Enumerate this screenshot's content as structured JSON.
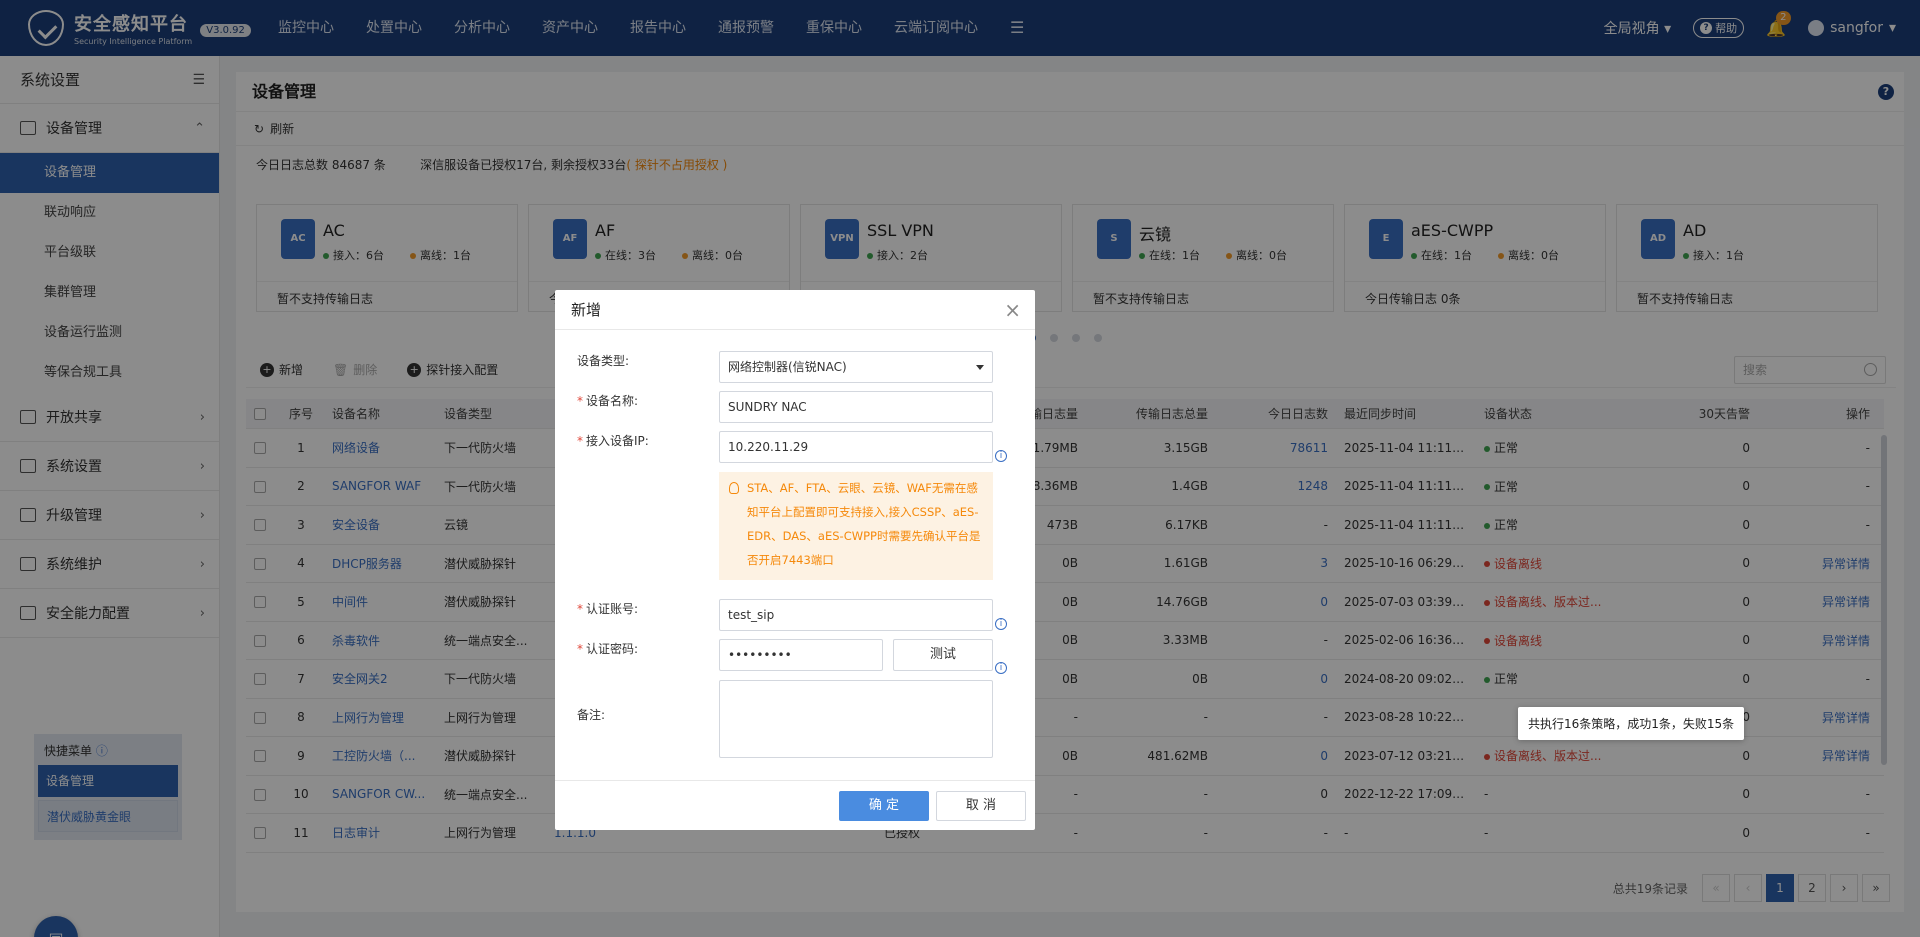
{
  "app": {
    "title": "安全感知平台",
    "subtitle": "Security Intelligence Platform",
    "version": "V3.0.92"
  },
  "nav": {
    "items": [
      "监控中心",
      "处置中心",
      "分析中心",
      "资产中心",
      "报告中心",
      "通报预警",
      "重保中心",
      "云端订阅中心"
    ],
    "more_icon": "hamburger-icon",
    "view_label": "全局视角",
    "help_label": "帮助",
    "bell_badge": "2",
    "user_label": "sangfor"
  },
  "sidebar": {
    "title": "系统设置",
    "groups": [
      {
        "label": "设备管理",
        "icon": "device-icon",
        "expanded": true
      },
      {
        "label": "开放共享",
        "icon": "share-icon"
      },
      {
        "label": "系统设置",
        "icon": "gear-icon"
      },
      {
        "label": "升级管理",
        "icon": "upload-icon"
      },
      {
        "label": "系统维护",
        "icon": "wrench-icon"
      },
      {
        "label": "安全能力配置",
        "icon": "grid-icon"
      }
    ],
    "subitems": [
      "设备管理",
      "联动响应",
      "平台级联",
      "集群管理",
      "设备运行监测",
      "等保合规工具"
    ],
    "quick_title": "快捷菜单",
    "quick_items": [
      "设备管理",
      "潜伏威胁黄金眼"
    ]
  },
  "main": {
    "title": "设备管理",
    "refresh_label": "刷新",
    "info_left": "今日日志总数 84687 条",
    "info_right": "深信服设备已授权17台, 剩余授权33台",
    "info_link": "( 探针不占用授权 )",
    "cards": [
      {
        "name": "AC",
        "stat1": "接入：6台",
        "stat2": "离线：1台",
        "foot": "暂不支持传输日志",
        "icon": "ac-icon",
        "icon_text": "AC"
      },
      {
        "name": "AF",
        "stat1": "在线：3台",
        "stat2": "离线：0台",
        "foot": "今日传输日志 0条",
        "icon": "af-icon",
        "icon_text": "AF"
      },
      {
        "name": "SSL VPN",
        "stat1": "接入：2台",
        "stat2": "",
        "foot": "暂不支持传输日志",
        "icon": "vpn-icon",
        "icon_text": "VPN"
      },
      {
        "name": "云镜",
        "stat1": "在线：1台",
        "stat2": "离线：0台",
        "foot": "暂不支持传输日志",
        "icon": "cloud-mirror-icon",
        "icon_text": "S"
      },
      {
        "name": "aES-CWPP",
        "stat1": "在线：1台",
        "stat2": "离线：0台",
        "foot": "今日传输日志 0条",
        "icon": "cwpp-icon",
        "icon_text": "E"
      },
      {
        "name": "AD",
        "stat1": "接入：1台",
        "stat2": "",
        "foot": "暂不支持传输日志",
        "icon": "ad-icon",
        "icon_text": "AD"
      }
    ],
    "toolbar": {
      "add": "新增",
      "delete": "删除",
      "probe": "探针接入配置",
      "search_placeholder": "搜索"
    },
    "columns": [
      "序号",
      "设备名称",
      "设备类型",
      "",
      "",
      "今日传输日志量",
      "传输日志总量",
      "今日日志数",
      "最近同步时间",
      "设备状态",
      "30天告警",
      "操作"
    ],
    "rows": [
      {
        "no": "1",
        "name": "网络设备",
        "type": "下一代防火墙",
        "ip": "",
        "c5": "",
        "today": "21.79MB",
        "total": "3.15GB",
        "count": "78611",
        "time": "2025-11-04 11:11:10",
        "status": "正常",
        "dot": "g",
        "alerts": "0",
        "op": "-"
      },
      {
        "no": "2",
        "name": "SANGFOR WAF",
        "type": "下一代防火墙",
        "ip": "",
        "c5": "",
        "today": "8.36MB",
        "total": "1.4GB",
        "count": "1248",
        "time": "2025-11-04 11:11:04",
        "status": "正常",
        "dot": "g",
        "alerts": "0",
        "op": "-"
      },
      {
        "no": "3",
        "name": "安全设备",
        "type": "云镜",
        "ip": "",
        "c5": "",
        "today": "473B",
        "total": "6.17KB",
        "count": "-",
        "time": "2025-11-04 11:11:02",
        "status": "正常",
        "dot": "g",
        "alerts": "0",
        "op": "-"
      },
      {
        "no": "4",
        "name": "DHCP服务器",
        "type": "潜伏威胁探针",
        "ip": "",
        "c5": "",
        "today": "0B",
        "total": "1.61GB",
        "count": "3",
        "time": "2025-10-16 06:29:47",
        "status": "设备离线",
        "dot": "r",
        "alerts": "0",
        "op": "异常详情"
      },
      {
        "no": "5",
        "name": "中间件",
        "type": "潜伏威胁探针",
        "ip": "",
        "c5": "",
        "today": "0B",
        "total": "14.76GB",
        "count": "0",
        "time": "2025-07-03 03:39:29",
        "status": "设备离线、版本过...",
        "dot": "r",
        "alerts": "0",
        "op": "异常详情"
      },
      {
        "no": "6",
        "name": "杀毒软件",
        "type": "统一端点安全...",
        "ip": "",
        "c5": "",
        "today": "0B",
        "total": "3.33MB",
        "count": "-",
        "time": "2025-02-06 16:36:08",
        "status": "设备离线",
        "dot": "r",
        "alerts": "0",
        "op": "异常详情"
      },
      {
        "no": "7",
        "name": "安全网关2",
        "type": "下一代防火墙",
        "ip": "",
        "c5": "",
        "today": "0B",
        "total": "0B",
        "count": "0",
        "time": "2024-08-20 09:02:13",
        "status": "正常",
        "dot": "g",
        "alerts": "0",
        "op": "-"
      },
      {
        "no": "8",
        "name": "上网行为管理",
        "type": "上网行为管理",
        "ip": "",
        "c5": "",
        "today": "-",
        "total": "-",
        "count": "-",
        "time": "2023-08-28 10:22:46",
        "status": "",
        "dot": "",
        "alerts": "0",
        "op": "异常详情"
      },
      {
        "no": "9",
        "name": "工控防火墙（...",
        "type": "潜伏威胁探针",
        "ip": "",
        "c5": "",
        "today": "0B",
        "total": "481.62MB",
        "count": "0",
        "time": "2023-07-12 03:21:32",
        "status": "设备离线、版本过...",
        "dot": "r",
        "alerts": "0",
        "op": "异常详情"
      },
      {
        "no": "10",
        "name": "SANGFOR CW...",
        "type": "统一端点安全...",
        "ip": "",
        "c5": "",
        "today": "-",
        "total": "-",
        "count": "0",
        "time": "2022-12-22 17:09:56",
        "status": "-",
        "dot": "",
        "alerts": "0",
        "op": "-"
      },
      {
        "no": "11",
        "name": "日志审计",
        "type": "上网行为管理",
        "ip": "1.1.1.0",
        "c5": "-",
        "c5b": "已授权",
        "c5c": "-",
        "today": "-",
        "total": "-",
        "count": "-",
        "time": "-",
        "status": "-",
        "dot": "",
        "alerts": "0",
        "op": "-"
      }
    ],
    "tooltip": "共执行16条策略，成功1条，失败15条",
    "pagination": {
      "total": "总共19条记录",
      "first": "«",
      "prev": "‹",
      "pages": [
        "1",
        "2"
      ],
      "next": "›",
      "last": "»"
    }
  },
  "modal": {
    "title": "新增",
    "fields": {
      "type_label": "设备类型:",
      "type_value": "网络控制器(信锐NAC)",
      "name_label": "设备名称:",
      "name_value": "SUNDRY NAC",
      "ip_label": "接入设备IP:",
      "ip_value": "10.220.11.29",
      "tip": "STA、AF、FTA、云眼、云镜、WAF无需在感知平台上配置即可支持接入,接入CSSP、aES-EDR、DAS、aES-CWPP时需要先确认平台是否开启7443端口",
      "account_label": "认证账号:",
      "account_value": "test_sip",
      "password_label": "认证密码:",
      "password_value": "•••••••••",
      "test_label": "测试",
      "remark_label": "备注:"
    },
    "ok_label": "确 定",
    "cancel_label": "取 消"
  }
}
